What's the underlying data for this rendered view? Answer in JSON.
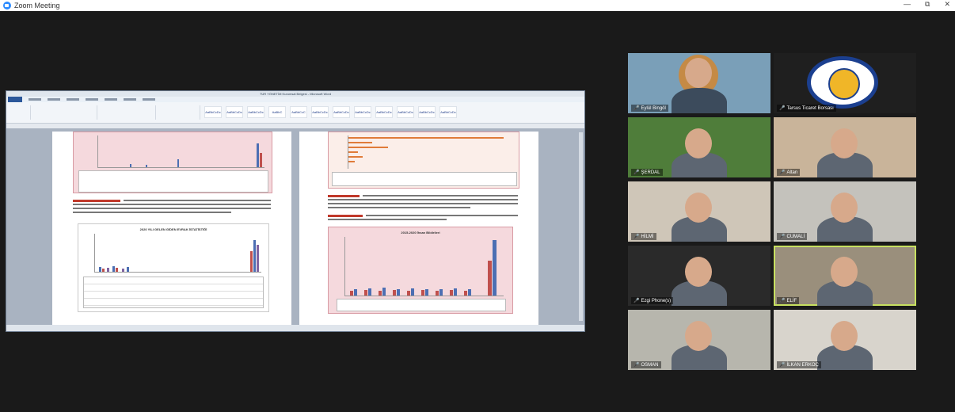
{
  "window": {
    "title": "Zoom Meeting",
    "controls": {
      "minimize": "—",
      "restore": "⧉",
      "close": "✕"
    }
  },
  "share": {
    "doc_title": "TÜR YÖNETİM Kurumsal Belgesi - Microsoft Word",
    "ribbon_styles": [
      "AaBbCcDc",
      "AaBbCcDc",
      "AaBbCcDc",
      "AaBbC",
      "AaBbCcC",
      "AaBbCcDc",
      "AaBbCcDc",
      "AaBbCcDc",
      "AaBbCcDc",
      "AaBbCcDc",
      "AaBbCcDc",
      "AaBbCcDc"
    ],
    "left_chart_title": "2020 YILI GELEN GİDEN EVRAK İSTATİSTİĞİ",
    "right_chart_title": "2015-2020 İhsan Bildirileri"
  },
  "participants": [
    {
      "name": "Eylül Bingöl",
      "bg": "#7a9fb8"
    },
    {
      "name": "Tarsus Ticaret Borsası",
      "bg": "#1f1f1f"
    },
    {
      "name": "ŞERDAL",
      "bg": "#4f7d3a"
    },
    {
      "name": "Altan",
      "bg": "#c9b49a"
    },
    {
      "name": "HİLMİ",
      "bg": "#cfc6b8"
    },
    {
      "name": "CUMALİ",
      "bg": "#c4c2bc"
    },
    {
      "name": "Ezgi Phone(s)",
      "bg": "#2a2a2a"
    },
    {
      "name": "ELİF",
      "bg": "#9a8f7c"
    },
    {
      "name": "OSMAN",
      "bg": "#b7b6ad"
    },
    {
      "name": "İLKAN ERKOÇ",
      "bg": "#d8d4cc"
    }
  ],
  "accent": "#c7e060"
}
